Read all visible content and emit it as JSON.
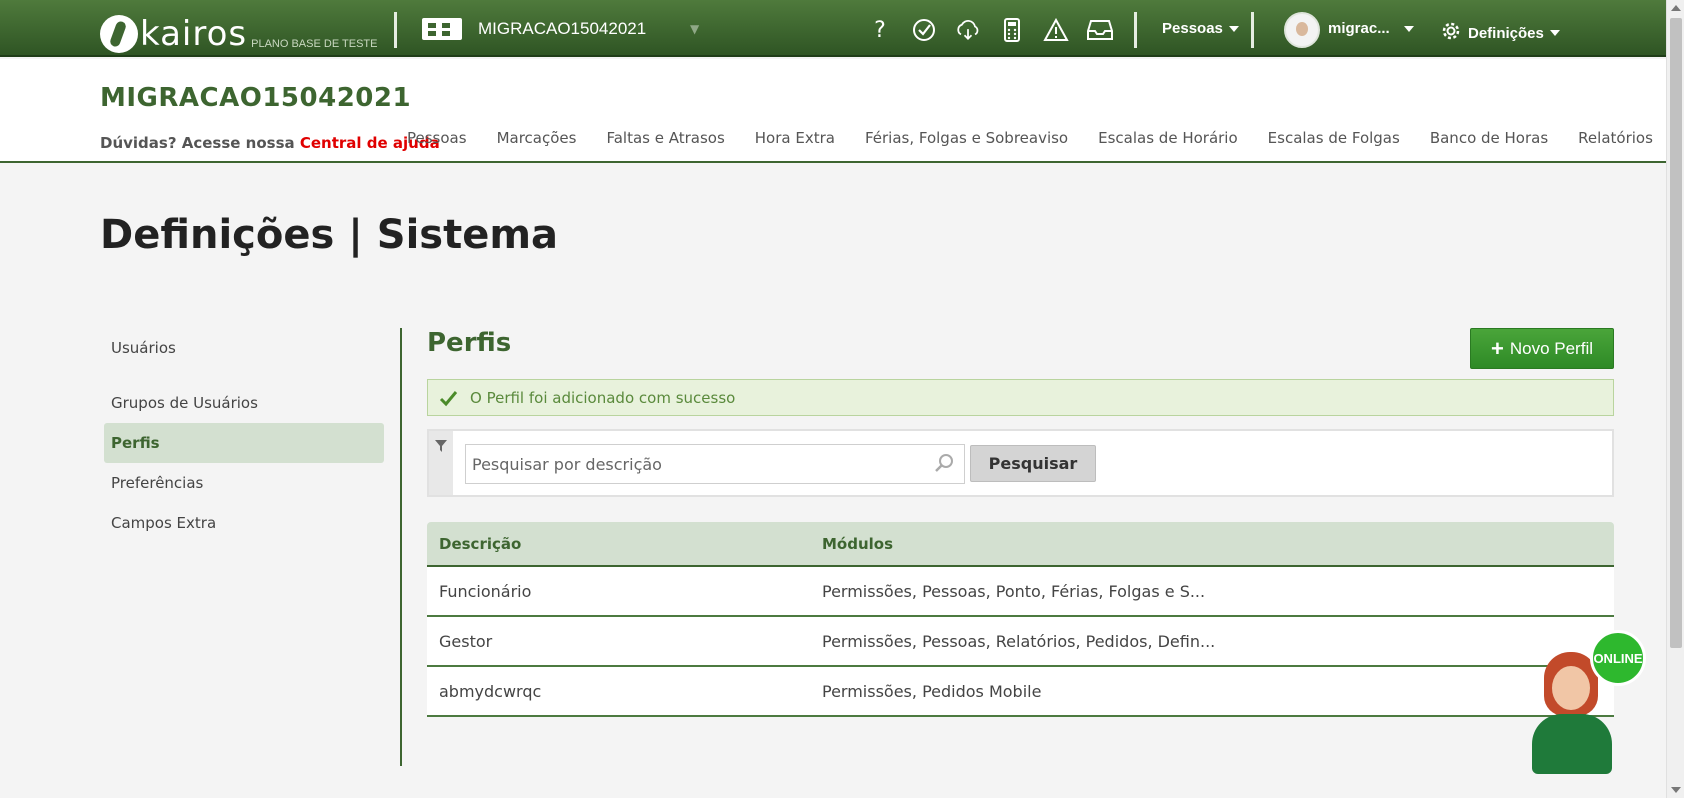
{
  "topbar": {
    "logo_text": "kairos",
    "logo_sub": "PLANO BASE DE TESTE",
    "company_name": "MIGRACAO15042021",
    "icons": [
      "help-icon",
      "clock-check-icon",
      "cloud-download-icon",
      "calculator-icon",
      "warning-icon",
      "inbox-icon"
    ],
    "pessoas_menu": "Pessoas",
    "user_name": "migrac...",
    "settings_menu": "Definições"
  },
  "header": {
    "title": "MIGRACAO15042021",
    "help_prefix": "Dúvidas? Acesse nossa ",
    "help_link": "Central de ajuda",
    "nav": [
      "Pessoas",
      "Marcações",
      "Faltas e Atrasos",
      "Hora Extra",
      "Férias, Folgas e Sobreaviso",
      "Escalas de Horário",
      "Escalas de Folgas",
      "Banco de Horas",
      "Relatórios"
    ]
  },
  "page_title": "Definições | Sistema",
  "sidenav": {
    "items": [
      "Usuários",
      "Grupos de Usuários",
      "Perfis",
      "Preferências",
      "Campos Extra"
    ],
    "active": "Perfis"
  },
  "content": {
    "section_title": "Perfis",
    "new_button": "Novo Perfil",
    "alert": "O Perfil foi adicionado com sucesso",
    "search_placeholder": "Pesquisar por descrição",
    "search_value": "",
    "search_button": "Pesquisar",
    "table": {
      "headers": [
        "Descrição",
        "Módulos"
      ],
      "rows": [
        [
          "Funcionário",
          "Permissões, Pessoas, Ponto, Férias, Folgas e S..."
        ],
        [
          "Gestor",
          "Permissões, Pessoas, Relatórios, Pedidos, Defin..."
        ],
        [
          "abmydcwrqc",
          "Permissões, Pedidos Mobile"
        ]
      ]
    }
  },
  "online_widget": {
    "label": "ONLINE"
  },
  "colors": {
    "brand_green": "#3d6530",
    "button_green": "#2e8a26",
    "link_red": "#e00000",
    "alert_bg": "#e8f2dc"
  }
}
